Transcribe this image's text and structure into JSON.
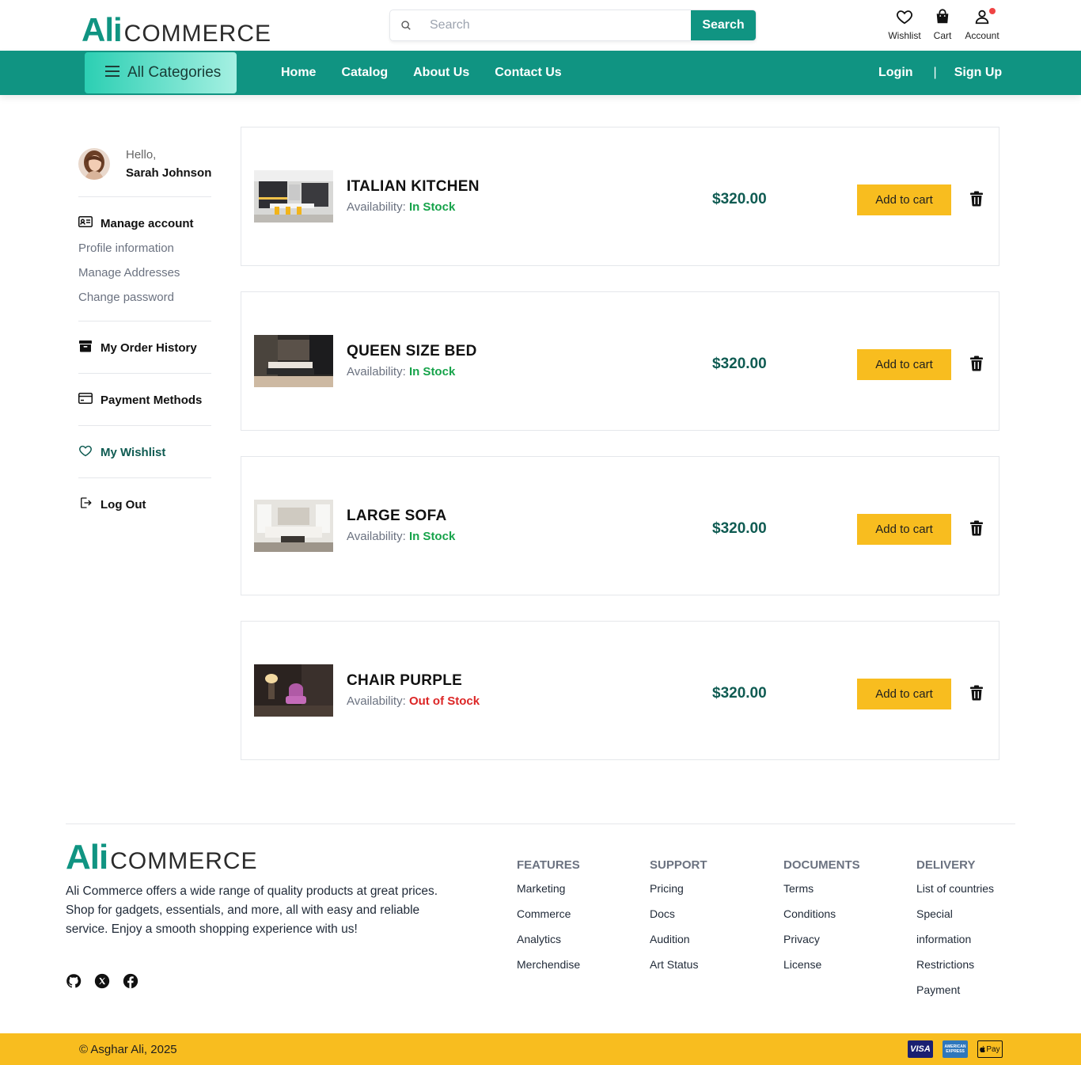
{
  "header": {
    "logo_primary": "Ali",
    "logo_secondary": "COMMERCE",
    "search_placeholder": "Search",
    "search_button": "Search",
    "icons": [
      {
        "name": "heart-icon",
        "label": "Wishlist"
      },
      {
        "name": "shopping-bag-icon",
        "label": "Cart"
      },
      {
        "name": "user-icon",
        "label": "Account"
      }
    ],
    "account_badge_color": "#ef4444"
  },
  "nav": {
    "all_categories": "All Categories",
    "links": [
      "Home",
      "Catalog",
      "About Us",
      "Contact Us"
    ],
    "login": "Login",
    "separator": "|",
    "signup": "Sign Up"
  },
  "sidebar": {
    "greeting": "Hello,",
    "user_name": "Sarah Johnson",
    "manage_account": "Manage account",
    "manage_items": [
      "Profile information",
      "Manage Addresses",
      "Change password"
    ],
    "order_history": "My Order History",
    "payment_methods": "Payment Methods",
    "wishlist": "My Wishlist",
    "logout": "Log Out"
  },
  "wishlist": {
    "availability_label": "Availability:",
    "add_to_cart": "Add to cart",
    "items": [
      {
        "name": "ITALIAN KITCHEN",
        "status": "In Stock",
        "in_stock": true,
        "price": "$320.00"
      },
      {
        "name": "QUEEN SIZE BED",
        "status": "In Stock",
        "in_stock": true,
        "price": "$320.00"
      },
      {
        "name": "LARGE SOFA",
        "status": "In Stock",
        "in_stock": true,
        "price": "$320.00"
      },
      {
        "name": "CHAIR PURPLE",
        "status": "Out of Stock",
        "in_stock": false,
        "price": "$320.00"
      }
    ]
  },
  "footer": {
    "logo_primary": "Ali",
    "logo_secondary": "COMMERCE",
    "description": "Ali Commerce offers a wide range of quality products at great prices. Shop for gadgets, essentials, and more, all with easy and reliable service. Enjoy a smooth shopping experience with us!",
    "social": [
      "github-icon",
      "x-icon",
      "facebook-icon"
    ],
    "columns": [
      {
        "title": "FEATURES",
        "items": [
          "Marketing",
          "Commerce",
          "Analytics",
          "Merchendise"
        ]
      },
      {
        "title": "SUPPORT",
        "items": [
          "Pricing",
          "Docs",
          "Audition",
          "Art Status"
        ]
      },
      {
        "title": "DOCUMENTS",
        "items": [
          "Terms",
          "Conditions",
          "Privacy",
          "License"
        ]
      },
      {
        "title": "DELIVERY",
        "items": [
          "List of countries",
          "Special",
          "information",
          "Restrictions",
          "Payment"
        ]
      }
    ],
    "copyright": "© Asghar Ali, 2025",
    "payment_badges": [
      "VISA",
      "AMERICAN EXPRESS",
      "Pay"
    ]
  },
  "colors": {
    "brand": "#109482",
    "accent": "#f8bd1f",
    "in_stock": "#16a34a",
    "out_of_stock": "#dc2626",
    "price": "#0f5b52"
  }
}
